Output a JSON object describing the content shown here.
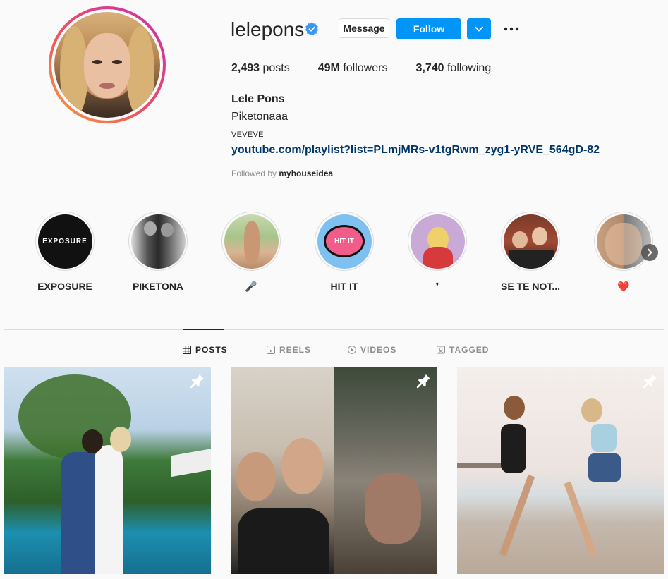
{
  "profile": {
    "username": "lelepons",
    "verified_icon": "verified-badge-icon",
    "message_label": "Message",
    "follow_label": "Follow",
    "stats": {
      "posts_count": "2,493",
      "posts_label": "posts",
      "followers_count": "49M",
      "followers_label": "followers",
      "following_count": "3,740",
      "following_label": "following"
    },
    "full_name": "Lele Pons",
    "bio": "Piketonaaa",
    "category": "VEVEVE",
    "link": "youtube.com/playlist?list=PLmjMRs-v1tgRwm_zyg1-yRVE_564gD-82",
    "followed_by_prefix": "Followed by",
    "followed_by_user": "myhouseidea"
  },
  "highlights": [
    {
      "label": "EXPOSURE"
    },
    {
      "label": "PIKETONA"
    },
    {
      "label": "🎤"
    },
    {
      "label": "HIT IT"
    },
    {
      "label": "❜"
    },
    {
      "label": "SE TE NOT..."
    },
    {
      "label": "❤️"
    }
  ],
  "highlight_texts": {
    "exposure_logo": "EXPOSURE",
    "hitit_logo": "HIT IT"
  },
  "tabs": [
    {
      "label": "POSTS",
      "icon": "grid-icon",
      "active": true
    },
    {
      "label": "REELS",
      "icon": "reels-icon",
      "active": false
    },
    {
      "label": "VIDEOS",
      "icon": "play-circle-icon",
      "active": false
    },
    {
      "label": "TAGGED",
      "icon": "tag-icon",
      "active": false
    }
  ],
  "colors": {
    "accent": "#0095f6",
    "link": "#00376b",
    "text": "#262626",
    "muted": "#8e8e8e",
    "background": "#fafafa"
  }
}
